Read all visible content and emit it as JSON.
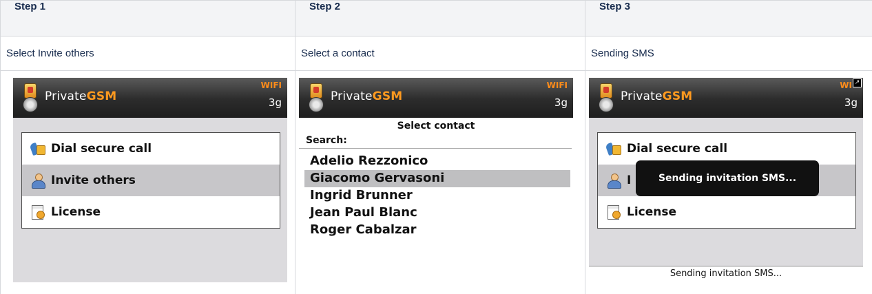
{
  "steps": [
    {
      "header": "Step 1",
      "description": "Select Invite others"
    },
    {
      "header": "Step 2",
      "description": "Select a contact"
    },
    {
      "header": "Step 3",
      "description": "Sending SMS"
    }
  ],
  "app": {
    "brand_prefix": "Private",
    "brand_suffix": "GSM",
    "wifi_label": "WIFI",
    "net_label": "3g",
    "wifi_short": "WI",
    "expand_glyph": "↗"
  },
  "menu": {
    "dial": "Dial secure call",
    "invite": "Invite others",
    "invite_partial": "I",
    "license": "License"
  },
  "contact_screen": {
    "title": "Select contact",
    "search_label": "Search:",
    "contacts": [
      "Adelio Rezzonico",
      "Giacomo Gervasoni",
      "Ingrid Brunner",
      "Jean Paul Blanc",
      "Roger Cabalzar"
    ]
  },
  "sending": {
    "toast": "Sending invitation SMS...",
    "status": "Sending invitation SMS..."
  },
  "colors": {
    "brand_accent": "#ff9a1f",
    "selection": "#c7c6c9",
    "toast_bg": "#111111"
  }
}
